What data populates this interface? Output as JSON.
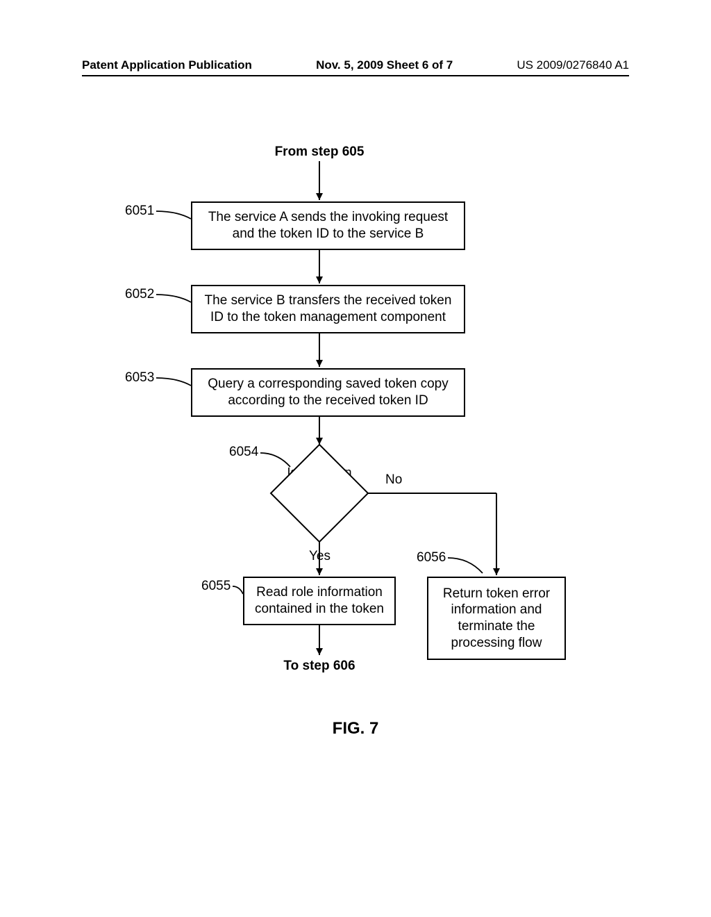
{
  "header": {
    "left": "Patent Application Publication",
    "center": "Nov. 5, 2009  Sheet 6 of 7",
    "right": "US 2009/0276840 A1"
  },
  "flow": {
    "from": "From step 605",
    "to": "To step 606",
    "step6051": {
      "ref": "6051",
      "text": "The service A sends the invoking request and the token ID to the service B"
    },
    "step6052": {
      "ref": "6052",
      "text": "The service B transfers the received token ID to the token management component"
    },
    "step6053": {
      "ref": "6053",
      "text": "Query a corresponding saved token copy according to the received token ID"
    },
    "decision6054": {
      "ref": "6054",
      "text": "Is the token active ?",
      "yes": "Yes",
      "no": "No"
    },
    "step6055": {
      "ref": "6055",
      "text": "Read role information contained in the token"
    },
    "step6056": {
      "ref": "6056",
      "text": "Return token error information and terminate the processing flow"
    }
  },
  "figure": "FIG. 7"
}
